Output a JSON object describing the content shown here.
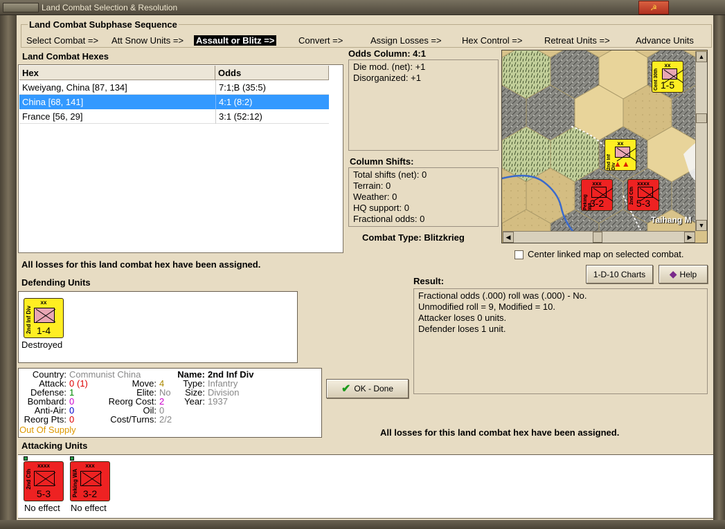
{
  "window": {
    "title": "Land Combat Selection & Resolution",
    "close_glyph": "☭"
  },
  "sequence": {
    "heading": "Land Combat Subphase Sequence",
    "steps": [
      "Select Combat =>",
      "Att Snow Units =>",
      "Assault or Blitz =>",
      "Convert =>",
      "Assign Losses =>",
      "Hex Control =>",
      "Retreat Units =>",
      "Advance Units"
    ]
  },
  "hexes": {
    "heading": "Land Combat Hexes",
    "col_hex": "Hex",
    "col_odds": "Odds",
    "rows": [
      {
        "hex": "Kweiyang, China [87, 134]",
        "odds": "7:1;B (35:5)"
      },
      {
        "hex": "China [68, 141]",
        "odds": "4:1 (8:2)"
      },
      {
        "hex": "France [56, 29]",
        "odds": "3:1 (52:12)"
      }
    ]
  },
  "odds": {
    "heading": "Odds Column: 4:1",
    "lines": [
      "Die mod. (net): +1",
      "Disorganized: +1"
    ]
  },
  "shifts": {
    "heading": "Column Shifts:",
    "lines": [
      "Total shifts (net): 0",
      "Terrain: 0",
      "Weather: 0",
      "HQ support: 0",
      "Fractional odds: 0"
    ]
  },
  "combat_type": "Combat Type:  Blitzkrieg",
  "map": {
    "label": "Taihang M",
    "center_checkbox": "Center linked map on selected combat.",
    "counters": [
      {
        "size": "xx",
        "strength": "1-5",
        "name": "Cent 30th"
      },
      {
        "size": "xx",
        "strength": "",
        "name": "2nd Inf Div"
      },
      {
        "size": "xxx",
        "strength": "3-2",
        "name": "Peking WA"
      },
      {
        "size": "xxxx",
        "strength": "5-3",
        "name": "2nd Cth"
      }
    ]
  },
  "losses_msg": "All losses for this land combat hex have been assigned.",
  "defending": {
    "heading": "Defending Units",
    "unit": {
      "size": "xx",
      "name": "2nd Inf Div",
      "strength": "1-4",
      "status": "Destroyed"
    }
  },
  "stats": {
    "country_label": "Country:",
    "country": "Communist China",
    "attack_label": "Attack:",
    "attack": "0",
    "attack_extra": "(1)",
    "defense_label": "Defense:",
    "defense": "1",
    "bombard_label": "Bombard:",
    "bombard": "0",
    "antiair_label": "Anti-Air:",
    "antiair": "0",
    "reorg_pts_label": "Reorg Pts:",
    "reorg_pts": "0",
    "supply": "Out Of Supply",
    "move_label": "Move:",
    "move": "4",
    "elite_label": "Elite:",
    "elite": "No",
    "reorg_cost_label": "Reorg Cost:",
    "reorg_cost": "2",
    "oil_label": "Oil:",
    "oil": "0",
    "cost_turns_label": "Cost/Turns:",
    "cost_turns": "2/2",
    "name_label": "Name:",
    "name": "2nd Inf Div",
    "type_label": "Type:",
    "type": "Infantry",
    "size_label": "Size:",
    "size": "Division",
    "year_label": "Year:",
    "year": "1937"
  },
  "buttons": {
    "charts": "1-D-10 Charts",
    "help": "Help",
    "ok": "OK - Done"
  },
  "result": {
    "heading": "Result:",
    "lines": [
      "Fractional odds (.000) roll was (.000)  - No.",
      "Unmodified roll = 9, Modified = 10.",
      "Attacker loses 0 units.",
      "Defender loses 1 unit."
    ]
  },
  "attacking": {
    "heading": "Attacking Units",
    "units": [
      {
        "size": "xxxx",
        "name": "2nd Cth",
        "strength": "5-3",
        "status": "No effect"
      },
      {
        "size": "xxx",
        "name": "Peking WA",
        "strength": "3-2",
        "status": "No effect"
      }
    ]
  },
  "colors": {
    "panel": "#e7dcc3",
    "selected_row": "#3399ff",
    "defender_counter": "#ffee22",
    "attacker_counter": "#ee2222",
    "attack_red": "#dd0000",
    "defense_green": "#008800",
    "bombard_magenta": "#cc00cc",
    "antiair_blue": "#0000cc",
    "supply_orange": "#dd9900"
  }
}
